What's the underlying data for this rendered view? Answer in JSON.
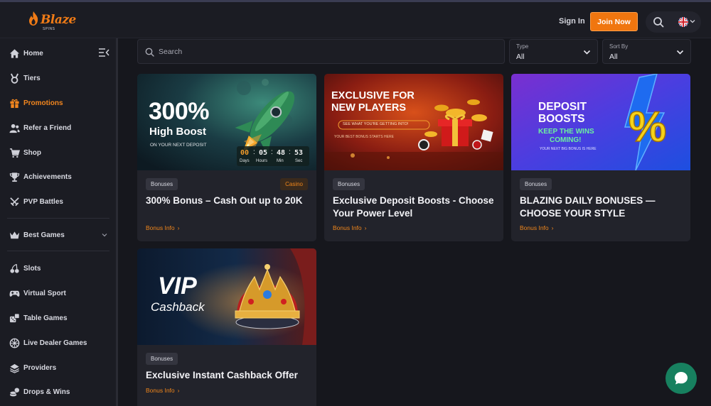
{
  "header": {
    "logo_text": "Blaze",
    "logo_sub": "SPINS",
    "signin_label": "Sign In",
    "join_label": "Join Now"
  },
  "sidebar": {
    "items": [
      {
        "label": "Home",
        "icon": "home-icon"
      },
      {
        "label": "Tiers",
        "icon": "medal-icon"
      },
      {
        "label": "Promotions",
        "icon": "gift-icon",
        "active": true
      },
      {
        "label": "Refer a Friend",
        "icon": "users-icon"
      },
      {
        "label": "Shop",
        "icon": "cart-icon"
      },
      {
        "label": "Achievements",
        "icon": "trophy-icon"
      },
      {
        "label": "PVP Battles",
        "icon": "swords-icon"
      }
    ],
    "best_games_label": "Best Games",
    "game_items": [
      {
        "label": "Slots",
        "icon": "cherries-icon"
      },
      {
        "label": "Virtual Sport",
        "icon": "gamepad-icon"
      },
      {
        "label": "Table Games",
        "icon": "dice-icon"
      },
      {
        "label": "Live Dealer Games",
        "icon": "roulette-icon"
      },
      {
        "label": "Providers",
        "icon": "stack-icon"
      },
      {
        "label": "Drops & Wins",
        "icon": "coins-icon"
      }
    ]
  },
  "filters": {
    "search_placeholder": "Search",
    "type_label": "Type",
    "type_value": "All",
    "sort_label": "Sort By",
    "sort_value": "All"
  },
  "promotions": [
    {
      "tag": "Bonuses",
      "tag2": "Casino",
      "title": "300% Bonus – Cash Out up to 20K",
      "link": "Bonus Info",
      "banner": {
        "headline": "300%",
        "subline": "High Boost",
        "small": "ON YOUR NEXT DEPOSIT",
        "timer": [
          "00",
          "05",
          "48",
          "53"
        ],
        "timer_labels": [
          "Days",
          "Hours",
          "Min",
          "Sec"
        ]
      }
    },
    {
      "tag": "Bonuses",
      "title": "Exclusive Deposit Boosts - Choose Your Power Level",
      "link": "Bonus Info",
      "banner": {
        "line1": "EXCLUSIVE FOR",
        "line2": "NEW PLAYERS",
        "button": "SEE WHAT YOU'RE GETTING INTO!",
        "small": "YOUR BEST BONUS STARTS HERE"
      }
    },
    {
      "tag": "Bonuses",
      "title": "BLAZING DAILY BONUSES — CHOOSE YOUR STYLE",
      "link": "Bonus Info",
      "banner": {
        "line1": "DEPOSIT",
        "line2": "BOOSTS",
        "line3": "KEEP THE WINS",
        "line4": "COMING!",
        "small": "YOUR NEXT BIG BONUS IS HERE"
      }
    },
    {
      "tag": "Bonuses",
      "title": "Exclusive Instant Cashback Offer",
      "link": "Bonus Info",
      "banner": {
        "line1": "VIP",
        "line2": "Cashback"
      }
    }
  ],
  "colors": {
    "accent": "#f0760f",
    "background": "#16171d",
    "card": "#22232b",
    "chat": "#17805f"
  }
}
